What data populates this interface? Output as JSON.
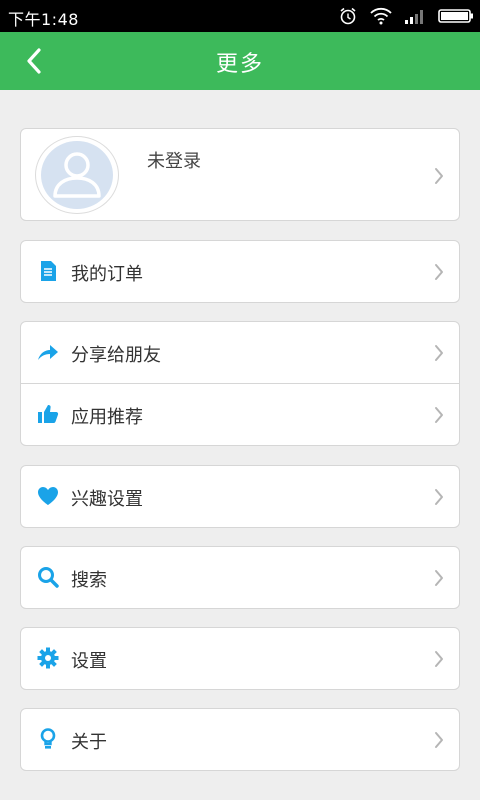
{
  "status_bar": {
    "time": "下午1:48",
    "icons": [
      "alarm-icon",
      "wifi-icon",
      "signal-icon",
      "battery-icon"
    ]
  },
  "app_bar": {
    "title": "更多",
    "back_icon": "chevron-left-icon",
    "color": "#3dba5b"
  },
  "profile": {
    "name": "未登录",
    "avatar_icon": "user-icon"
  },
  "menu": {
    "orders": {
      "label": "我的订单",
      "icon": "document-icon"
    },
    "share": {
      "label": "分享给朋友",
      "icon": "share-icon"
    },
    "recommend": {
      "label": "应用推荐",
      "icon": "thumbs-up-icon"
    },
    "interests": {
      "label": "兴趣设置",
      "icon": "heart-icon"
    },
    "search": {
      "label": "搜索",
      "icon": "search-icon"
    },
    "settings": {
      "label": "设置",
      "icon": "gear-icon"
    },
    "about": {
      "label": "关于",
      "icon": "lightbulb-icon"
    }
  },
  "colors": {
    "accent": "#3dba5b",
    "icon_blue": "#1aa3e8",
    "background": "#eeeeee"
  }
}
